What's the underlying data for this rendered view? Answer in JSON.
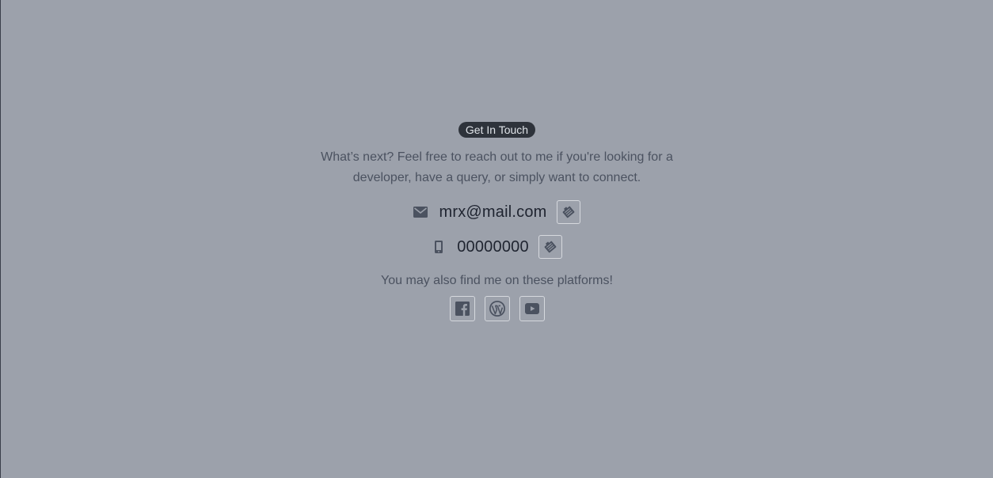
{
  "contact": {
    "badge_label": "Get In Touch",
    "intro_text": "What’s next? Feel free to reach out to me if you're looking for a developer, have a query, or simply want to connect.",
    "email": "mrx@mail.com",
    "phone": "00000000",
    "platforms_text": "You may also find me on these platforms!"
  },
  "icons": {
    "email": "mail-icon",
    "phone": "phone-icon",
    "copy": "copy-icon",
    "social": [
      "facebook-icon",
      "wordpress-icon",
      "youtube-icon"
    ]
  },
  "colors": {
    "background": "#9ca1ab",
    "badge_background": "#2e333b",
    "badge_text": "#dfe3e8",
    "body_text": "#4b5260",
    "value_text": "#1f2430",
    "icon": "#4b5260",
    "button_border": "#d6d9de"
  }
}
